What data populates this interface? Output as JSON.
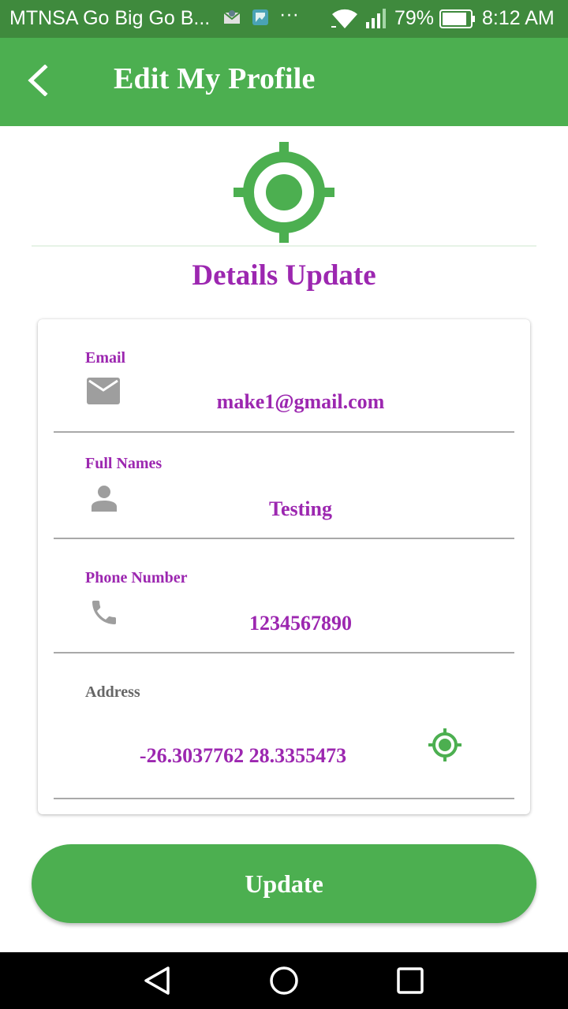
{
  "status_bar": {
    "carrier": "MTNSA Go Big Go B...",
    "overflow": "···",
    "battery_percent": "79%",
    "time": "8:12 AM",
    "icons": [
      "mail-notification-icon",
      "image-notification-icon",
      "wifi-icon",
      "signal-icon",
      "battery-icon"
    ]
  },
  "app_bar": {
    "title": "Edit My Profile",
    "back_icon": "chevron-left-icon"
  },
  "header": {
    "icon": "gps-target-icon",
    "title": "Details Update"
  },
  "form": {
    "fields": [
      {
        "label": "Email",
        "icon": "email-icon",
        "value": "make1@gmail.com"
      },
      {
        "label": "Full Names",
        "icon": "person-icon",
        "value": "Testing"
      },
      {
        "label": "Phone Number",
        "icon": "phone-icon",
        "value": "1234567890"
      },
      {
        "label": "Address",
        "icon": "gps-target-icon",
        "value": "-26.3037762 28.3355473"
      }
    ]
  },
  "actions": {
    "update_label": "Update"
  },
  "nav_bar": {
    "icons": [
      "back-triangle-icon",
      "home-circle-icon",
      "recents-square-icon"
    ]
  },
  "colors": {
    "primary": "#4caf50",
    "status_bar": "#3f8a3d",
    "accent_text": "#9c27b0",
    "icon_grey": "#9e9e9e"
  }
}
